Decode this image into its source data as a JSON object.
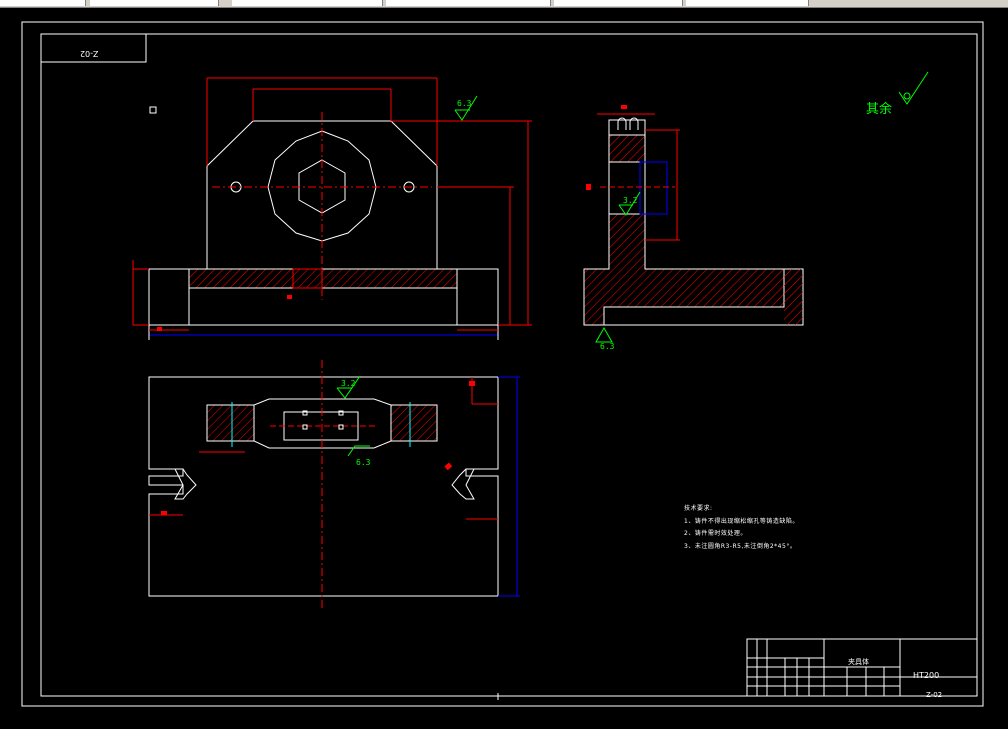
{
  "window": {
    "tabs": [
      "",
      "",
      "",
      "",
      "",
      ""
    ]
  },
  "drawing": {
    "drawing_number_corner": "Z-02",
    "roughness_note": "其余",
    "roughness_values": [
      "6.3",
      "6.3",
      "3.2",
      "6.3",
      "3.2",
      "3.2"
    ],
    "technical_requirements": {
      "title": "技术要求:",
      "items": [
        "1、铸件不得出现缩松缩孔等铸造缺陷。",
        "2、铸件需时效处理。",
        "3、未注圆角R3-R5,未注倒角2*45°。"
      ]
    },
    "title_block": {
      "part_name": "夹具体",
      "material": "HT200",
      "drawing_number": "Z-02"
    }
  },
  "colors": {
    "background": "#000000",
    "outline": "#ffffff",
    "dimension": "#ff0000",
    "roughness": "#00ff00",
    "hidden": "#0000ff",
    "hatch": "#ff0000"
  }
}
